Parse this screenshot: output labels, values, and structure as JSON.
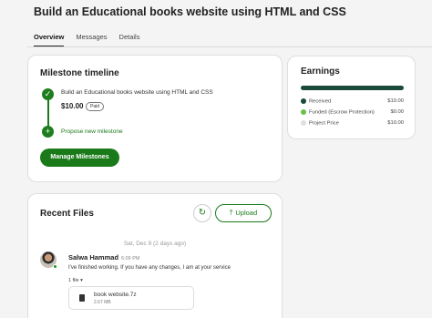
{
  "header": {
    "title": "Build an Educational books website using HTML and CSS",
    "tabs": [
      "Overview",
      "Messages",
      "Details"
    ]
  },
  "milestones": {
    "title": "Milestone timeline",
    "item": {
      "name": "Build an Educational books website using HTML and CSS",
      "amount": "$10.00",
      "status": "Paid"
    },
    "propose_label": "Propose new milestone",
    "manage_button": "Manage Milestones"
  },
  "earnings": {
    "title": "Earnings",
    "rows": [
      {
        "label": "Received",
        "value": "$10.00",
        "color": "#1a4a3a"
      },
      {
        "label": "Funded (Escrow Protection)",
        "value": "$0.00",
        "color": "#6abf4b"
      },
      {
        "label": "Project Price",
        "value": "$10.00",
        "color": "#e0e0e0"
      }
    ]
  },
  "files": {
    "title": "Recent Files",
    "upload_label": "Upload",
    "date": "Sat, Dec 9 (2 days ago)",
    "message": {
      "sender": "Salwa Hammad",
      "time": "6:09 PM",
      "text": "I've finished working. If you have any changes, I am at your service",
      "file_count": "1 file"
    },
    "file": {
      "name": "book website.7z",
      "size": "2.67 MB"
    }
  },
  "colors": {
    "accent": "#1a7a1a",
    "earnings_bar": "#1a4a3a"
  }
}
